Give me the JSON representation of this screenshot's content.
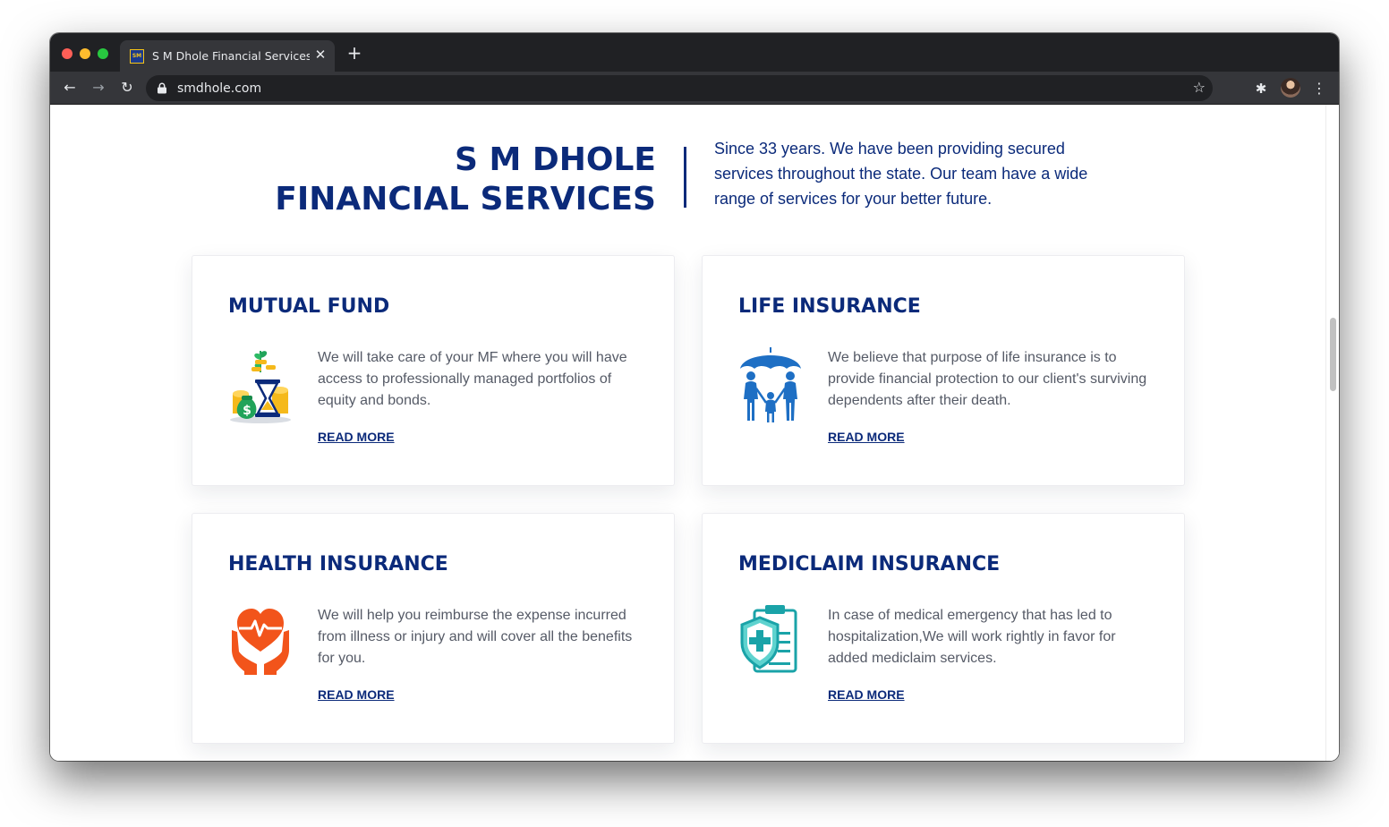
{
  "browser": {
    "tab_title": "S M Dhole Financial Services -",
    "favicon_text": "SM",
    "tab_close": "✕",
    "new_tab": "+",
    "url": "smdhole.com",
    "icons": {
      "back": "←",
      "forward": "→",
      "reload": "↻",
      "star": "☆",
      "extensions": "✱",
      "menu": "⋮"
    }
  },
  "hero": {
    "title_line1": "S M DHOLE",
    "title_line2": "FINANCIAL SERVICES",
    "description": "Since 33 years. We have been providing secured services throughout the state. Our team have a wide range of services for your better future."
  },
  "services": [
    {
      "title": "MUTUAL FUND",
      "text": "We will take care of your MF where you will have access to professionally managed portfolios of equity and bonds.",
      "link": "READ MORE",
      "icon": "money-bag-hourglass-icon"
    },
    {
      "title": "LIFE INSURANCE",
      "text": "We believe that purpose of life insurance is to provide financial protection to our client's surviving dependents after their death.",
      "link": "READ MORE",
      "icon": "family-umbrella-icon"
    },
    {
      "title": "HEALTH INSURANCE",
      "text": "We will help you reimburse the expense incurred from illness or injury and will cover all the benefits for you.",
      "link": "READ MORE",
      "icon": "heart-hands-icon"
    },
    {
      "title": "MEDICLAIM INSURANCE",
      "text": "In case of medical emergency that has led to hospitalization,We will work rightly in favor for added mediclaim services.",
      "link": "READ MORE",
      "icon": "medical-shield-clipboard-icon"
    }
  ],
  "colors": {
    "brand_navy": "#0b2a7a",
    "body_text": "#555a66",
    "life_blue": "#1e6fc4",
    "health_orange": "#f2541b",
    "mediclaim_teal": "#1aa3a8",
    "money_green": "#21a35a",
    "coin_gold": "#f5b91b"
  }
}
